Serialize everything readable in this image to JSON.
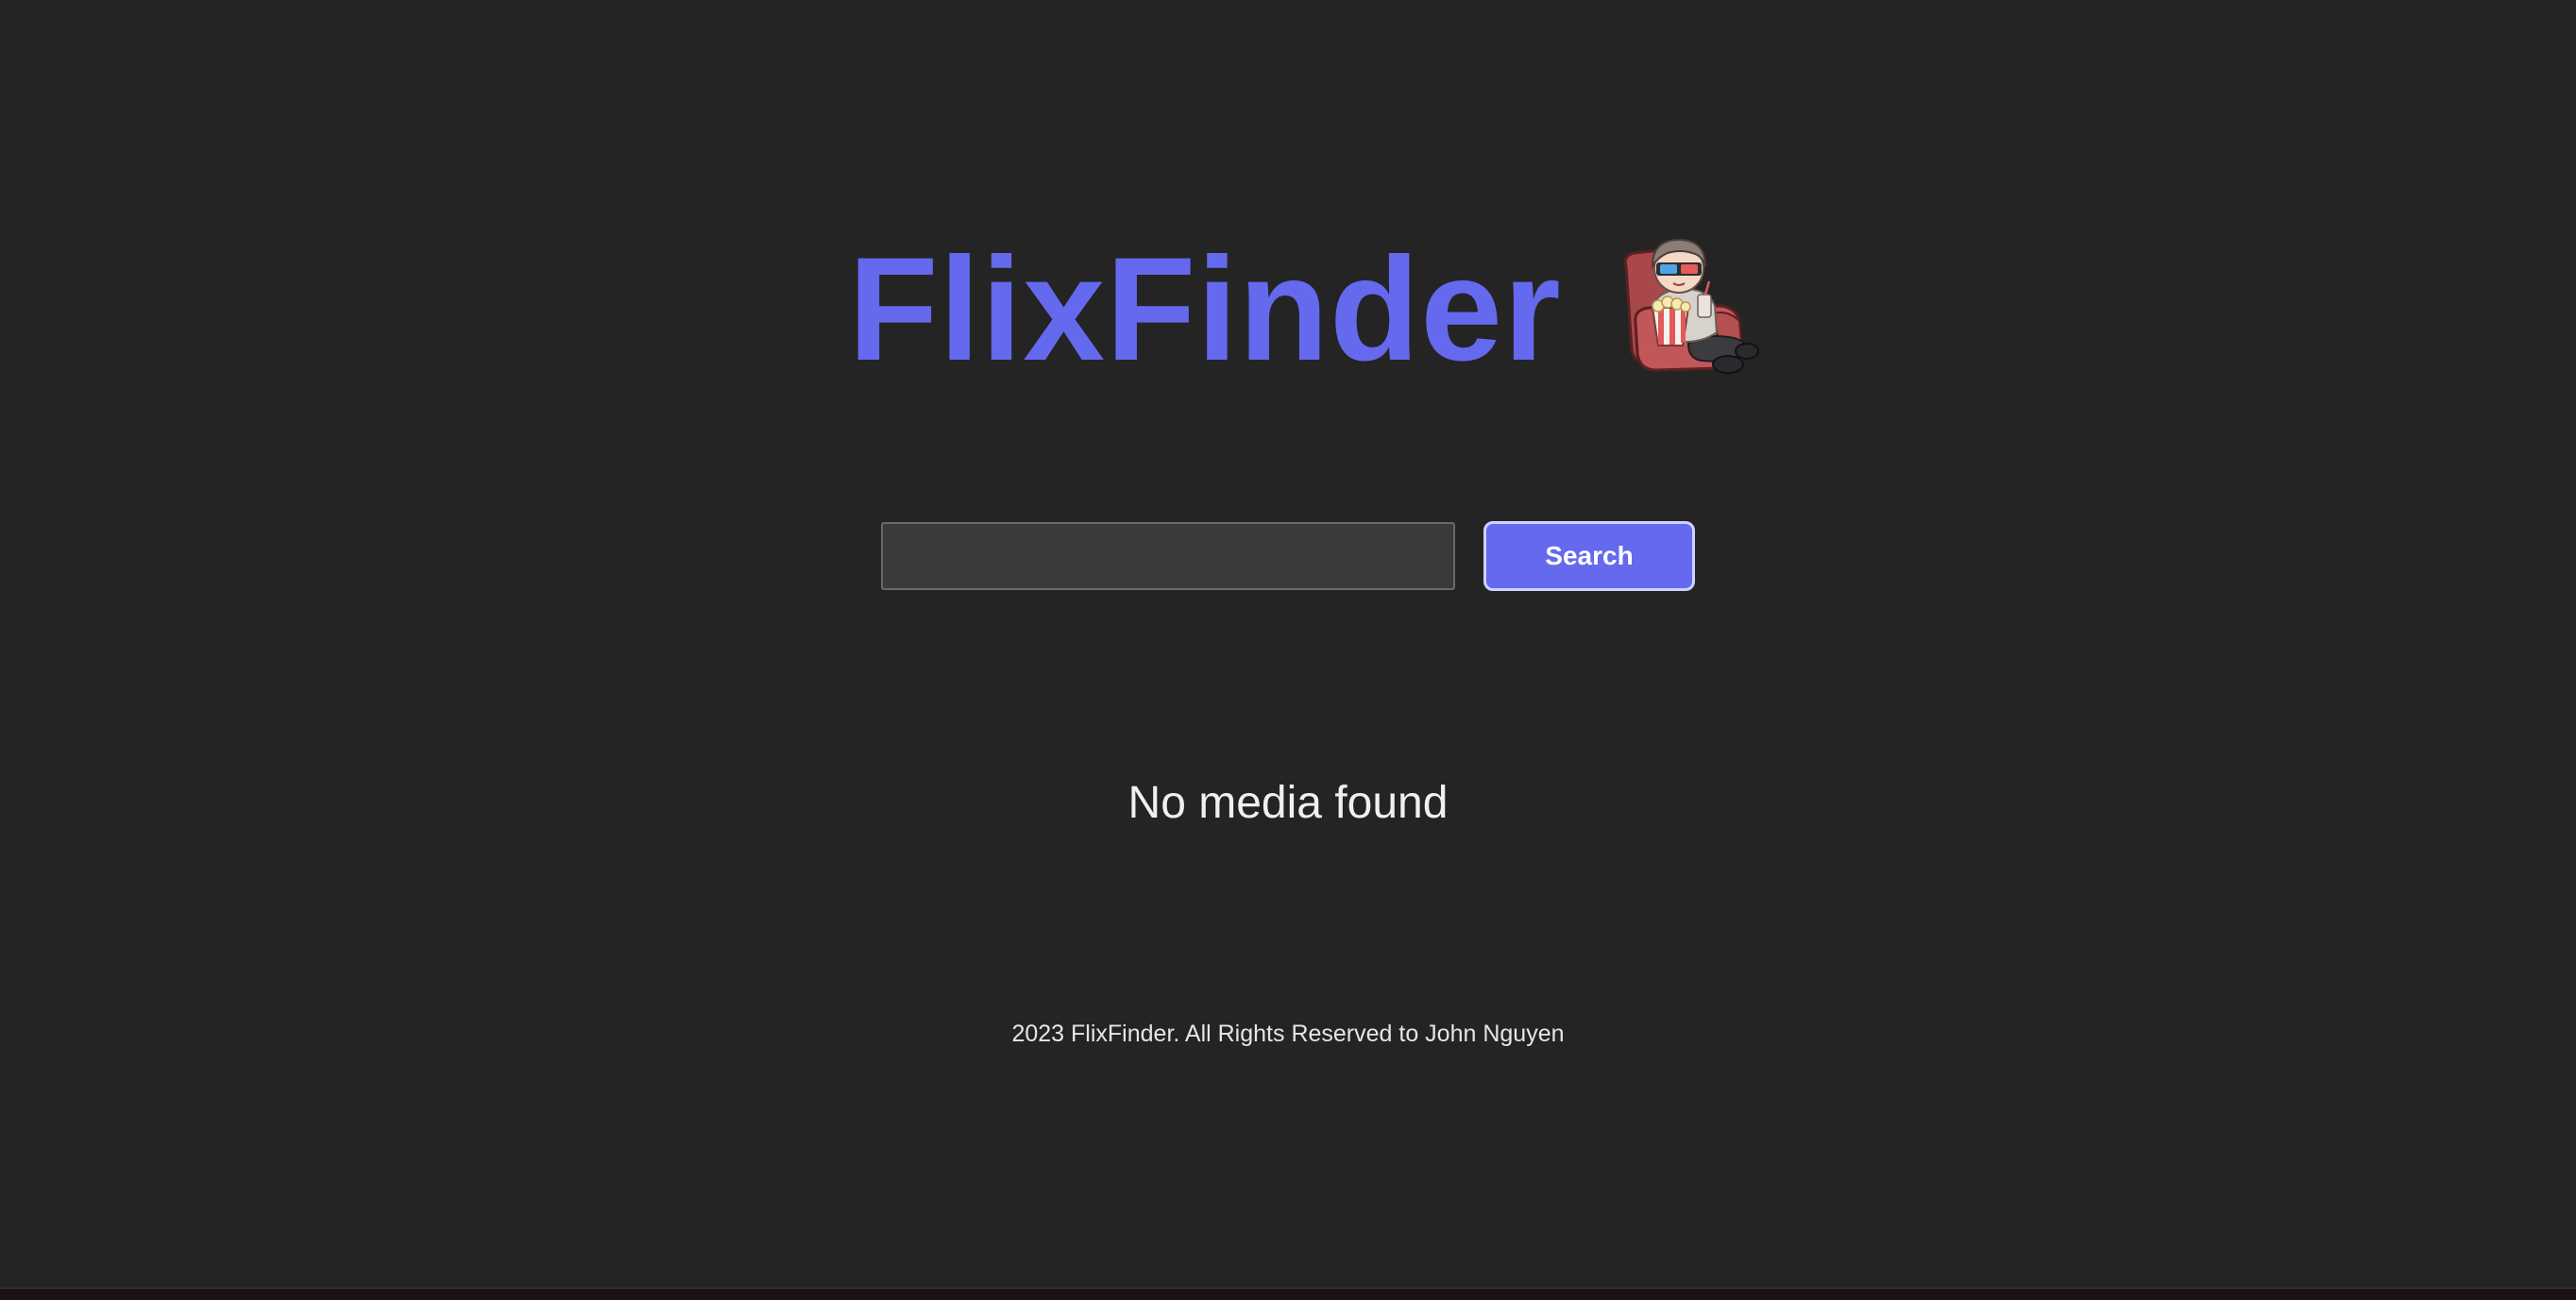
{
  "header": {
    "title": "FlixFinder",
    "mascot_icon": "popcorn-moviegoer-mascot-icon"
  },
  "search": {
    "value": "",
    "placeholder": "",
    "button_label": "Search"
  },
  "results": {
    "empty_message": "No media found"
  },
  "footer": {
    "text": "2023 FlixFinder. All Rights Reserved to John Nguyen"
  },
  "colors": {
    "background": "#242424",
    "accent": "#6469ee",
    "input_background": "#3a3a3a",
    "text": "#f0f0f0"
  }
}
